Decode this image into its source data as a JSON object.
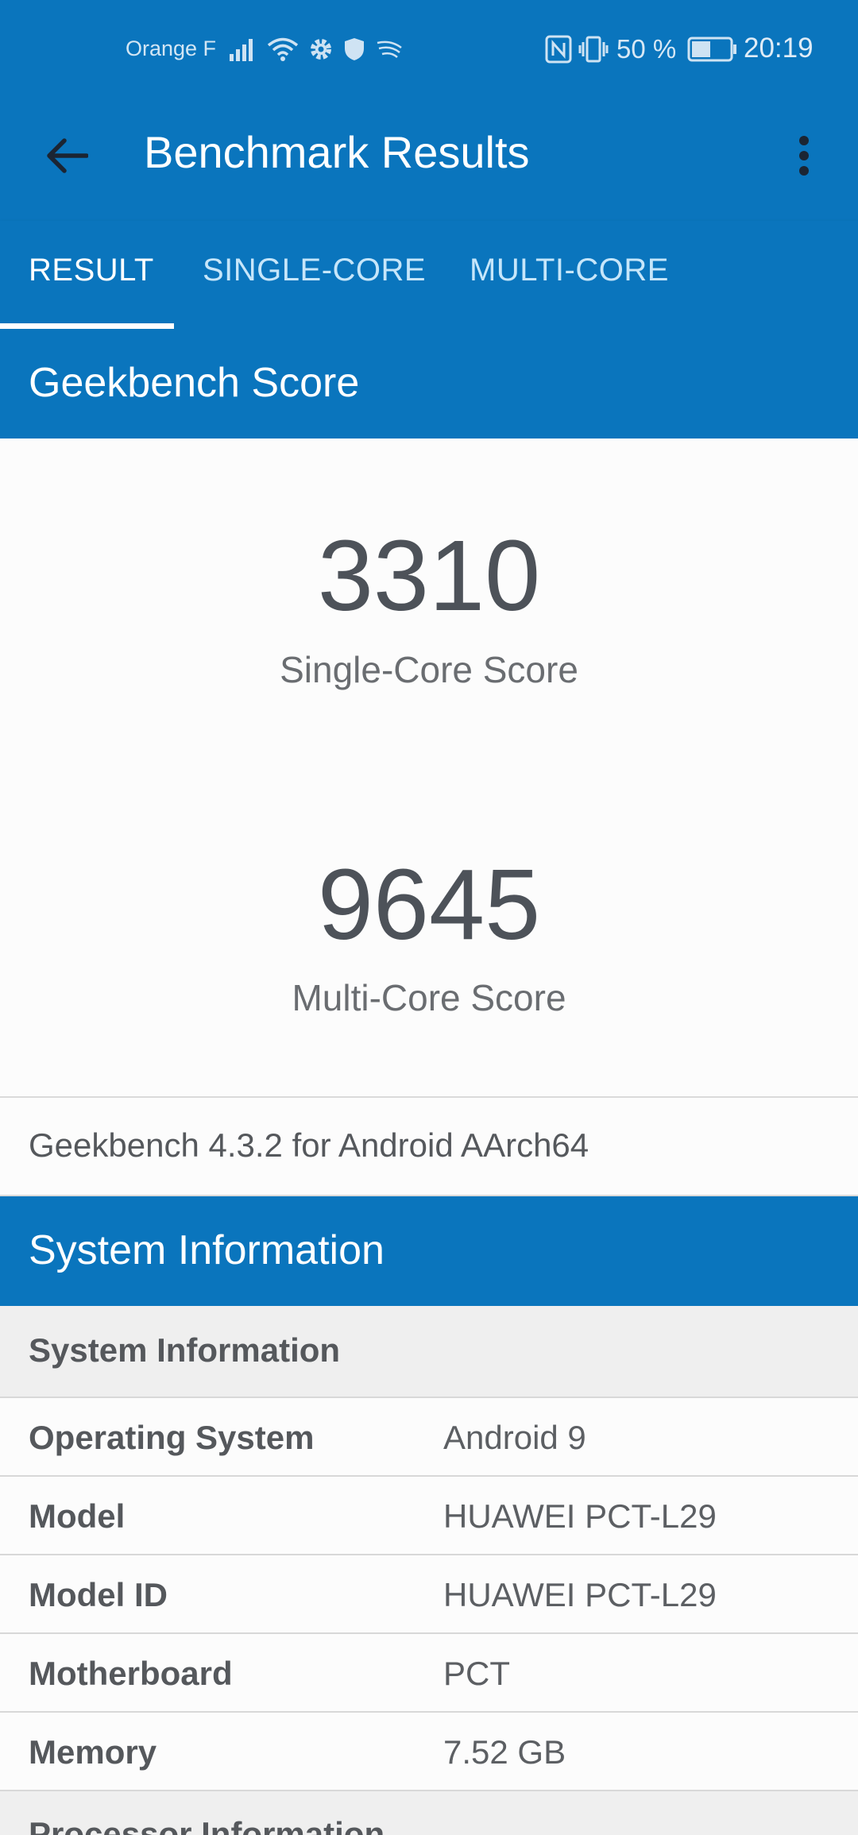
{
  "status_bar": {
    "carrier": "Orange F",
    "battery_percent": "50 %",
    "battery_level": 0.5,
    "time": "20:19",
    "icons_left": [
      "signal-icon",
      "wifi-icon",
      "settings-icon",
      "shield-icon",
      "swiftkey-icon"
    ],
    "icons_right": [
      "nfc-icon",
      "vibrate-icon",
      "battery-icon"
    ]
  },
  "app_bar": {
    "title": "Benchmark Results",
    "back_icon": "arrow-back-icon",
    "menu_icon": "more-vert-icon"
  },
  "tabs": [
    {
      "label": "RESULT",
      "active": true
    },
    {
      "label": "SINGLE-CORE",
      "active": false
    },
    {
      "label": "MULTI-CORE",
      "active": false
    }
  ],
  "geekbench_section": {
    "header": "Geekbench Score",
    "single_core": {
      "value": "3310",
      "label": "Single-Core Score"
    },
    "multi_core": {
      "value": "9645",
      "label": "Multi-Core Score"
    },
    "version": "Geekbench 4.3.2 for Android AArch64"
  },
  "system_section": {
    "header": "System Information",
    "subheader": "System Information",
    "rows": [
      {
        "key": "Operating System",
        "value": "Android 9"
      },
      {
        "key": "Model",
        "value": "HUAWEI PCT-L29"
      },
      {
        "key": "Model ID",
        "value": "HUAWEI PCT-L29"
      },
      {
        "key": "Motherboard",
        "value": "PCT"
      },
      {
        "key": "Memory",
        "value": "7.52 GB"
      }
    ],
    "next_subheader": "Processor Information"
  },
  "colors": {
    "accent": "#0a75bd",
    "text_dark": "#4d5259",
    "row_header_bg": "#efefef"
  }
}
